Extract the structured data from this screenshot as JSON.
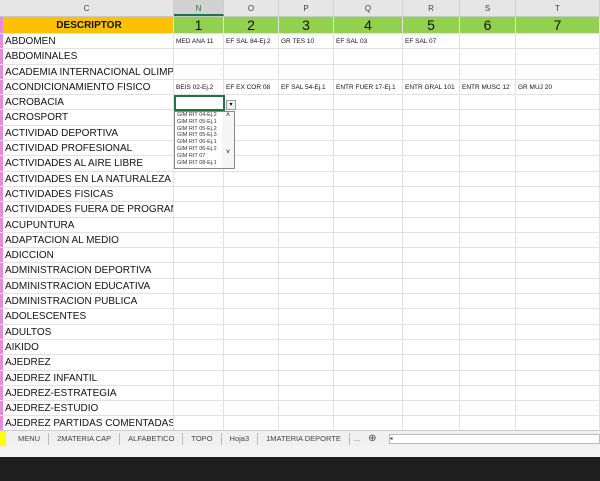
{
  "columns": [
    "C",
    "N",
    "O",
    "P",
    "Q",
    "R",
    "S",
    "T"
  ],
  "header_row": [
    "DESCRIPTOR",
    "1",
    "2",
    "3",
    "4",
    "5",
    "6",
    "7"
  ],
  "rows": [
    [
      "ABDOMEN",
      "MED ANA 11",
      "EF SAL 84-Ej.2",
      "GR TES 10",
      "EF SAL 03",
      "EF SAL 07",
      "",
      ""
    ],
    [
      "ABDOMINALES",
      "",
      "",
      "",
      "",
      "",
      "",
      ""
    ],
    [
      "ACADEMIA INTERNACIONAL OLIMPICA",
      "",
      "",
      "",
      "",
      "",
      "",
      ""
    ],
    [
      "ACONDICIONAMIENTO FISICO",
      "BEIS 02-Ej.2",
      "EF EX COR 08",
      "EF SAL 54-Ej.1",
      "ENTR FUER 17-Ej.1",
      "ENTR GRAL 101",
      "ENTR MUSC 12",
      "GR MUJ 20"
    ],
    [
      "ACROBACIA",
      "",
      "",
      "",
      "",
      "",
      "",
      ""
    ],
    [
      "ACROSPORT",
      "",
      "",
      "",
      "",
      "",
      "",
      ""
    ],
    [
      "ACTIVIDAD DEPORTIVA",
      "",
      "",
      "",
      "",
      "",
      "",
      ""
    ],
    [
      "ACTIVIDAD PROFESIONAL",
      "",
      "",
      "",
      "",
      "",
      "",
      ""
    ],
    [
      "ACTIVIDADES AL AIRE LIBRE",
      "",
      "",
      "",
      "",
      "",
      "",
      ""
    ],
    [
      "ACTIVIDADES EN LA NATURALEZA",
      "",
      "",
      "",
      "",
      "",
      "",
      ""
    ],
    [
      "ACTIVIDADES FISICAS",
      "",
      "",
      "",
      "",
      "",
      "",
      ""
    ],
    [
      "ACTIVIDADES FUERA DE PROGRAMA",
      "",
      "",
      "",
      "",
      "",
      "",
      ""
    ],
    [
      "ACUPUNTURA",
      "",
      "",
      "",
      "",
      "",
      "",
      ""
    ],
    [
      "ADAPTACION AL MEDIO",
      "",
      "",
      "",
      "",
      "",
      "",
      ""
    ],
    [
      "ADICCION",
      "",
      "",
      "",
      "",
      "",
      "",
      ""
    ],
    [
      "ADMINISTRACION DEPORTIVA",
      "",
      "",
      "",
      "",
      "",
      "",
      ""
    ],
    [
      "ADMINISTRACION EDUCATIVA",
      "",
      "",
      "",
      "",
      "",
      "",
      ""
    ],
    [
      "ADMINISTRACION PUBLICA",
      "",
      "",
      "",
      "",
      "",
      "",
      ""
    ],
    [
      "ADOLESCENTES",
      "",
      "",
      "",
      "",
      "",
      "",
      ""
    ],
    [
      "ADULTOS",
      "",
      "",
      "",
      "",
      "",
      "",
      ""
    ],
    [
      "AIKIDO",
      "",
      "",
      "",
      "",
      "",
      "",
      ""
    ],
    [
      "AJEDREZ",
      "",
      "",
      "",
      "",
      "",
      "",
      ""
    ],
    [
      "AJEDREZ INFANTIL",
      "",
      "",
      "",
      "",
      "",
      "",
      ""
    ],
    [
      "AJEDREZ-ESTRATEGIA",
      "",
      "",
      "",
      "",
      "",
      "",
      ""
    ],
    [
      "AJEDREZ-ESTUDIO",
      "",
      "",
      "",
      "",
      "",
      "",
      ""
    ],
    [
      "AJEDREZ PARTIDAS COMENTADAS",
      "",
      "",
      "",
      "",
      "",
      "",
      ""
    ]
  ],
  "dropdown": {
    "items": [
      "GIM RIT 04-Ej.2",
      "GIM RIT 05-Ej.1",
      "GIM RIT 05-Ej.2",
      "GIM RIT 05-Ej.3",
      "GIM RIT 06-Ej.1",
      "GIM RIT 06-Ej.2",
      "GIM RIT 07",
      "GIM RIT 08-Ej.1"
    ]
  },
  "sheet_tabs": [
    "MENU",
    "2MATERIA CAP",
    "ALFABETICO",
    "TOPO",
    "Hoja3",
    "1MATERIA DEPORTE"
  ],
  "tabs_more": "...",
  "add_sheet": "⊕"
}
